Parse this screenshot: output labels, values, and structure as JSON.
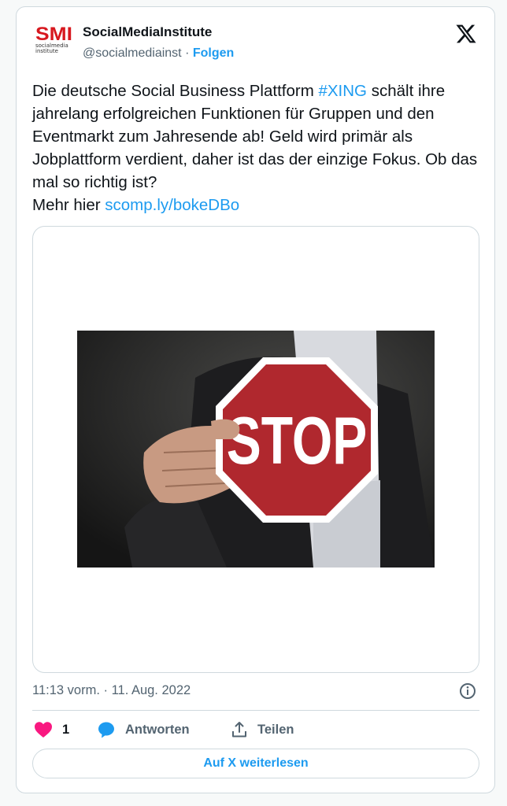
{
  "account": {
    "logo_mark": "SMI",
    "logo_sub_line1": "socialmedia",
    "logo_sub_line2": "institute",
    "display_name": "SocialMediaInstitute",
    "handle": "@socialmediainst",
    "separator": "·",
    "follow_label": "Folgen"
  },
  "platform_icon": "x-logo-icon",
  "tweet": {
    "text_part1": "Die deutsche Social Business Plattform ",
    "hashtag": "#XING",
    "text_part2": " schält ihre jahrelang erfolgreichen Funktionen für Gruppen und den Eventmarkt zum Jahresende ab! Geld wird primär als Jobplattform verdient, daher ist das der einzige Fokus. Ob das mal so richtig ist?",
    "text_part3": "Mehr hier ",
    "link": "scomp.ly/bokeDBo"
  },
  "media": {
    "sign_text": "STOP"
  },
  "meta": {
    "timestamp": "11:13 vorm. · 11. Aug. 2022"
  },
  "actions": {
    "like_count": "1",
    "reply_label": "Antworten",
    "share_label": "Teilen"
  },
  "read_more_label": "Auf X weiterlesen",
  "colors": {
    "accent": "#1d9bf0",
    "like": "#f91880",
    "brand_red": "#d7181f",
    "stop_red": "#b0282e"
  }
}
